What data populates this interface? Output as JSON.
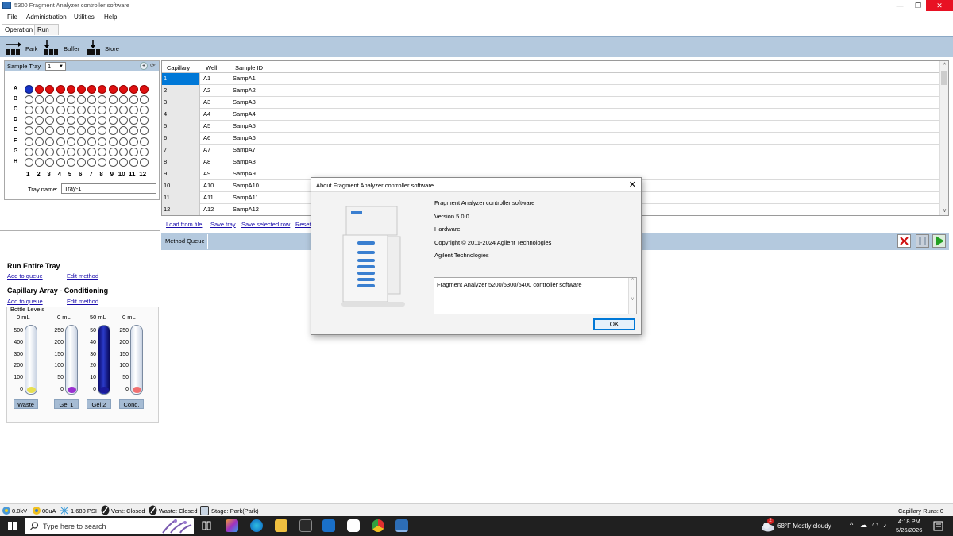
{
  "window": {
    "title": "5300 Fragment Analyzer controller software",
    "minimize": "—",
    "restore": "❐",
    "close": "✕"
  },
  "menu": [
    "File",
    "Administration",
    "Utilities",
    "Help"
  ],
  "tabs": [
    "Operation",
    "Run Status"
  ],
  "toolbar": {
    "park": "Park",
    "buffer": "Buffer",
    "store": "Store"
  },
  "tray": {
    "header_label": "Sample Tray",
    "selected": "1",
    "rows": [
      "A",
      "B",
      "C",
      "D",
      "E",
      "F",
      "G",
      "H"
    ],
    "cols": [
      "1",
      "2",
      "3",
      "4",
      "5",
      "6",
      "7",
      "8",
      "9",
      "10",
      "11",
      "12"
    ],
    "row_a_states": [
      "selected",
      "filled",
      "filled",
      "filled",
      "filled",
      "filled",
      "filled",
      "filled",
      "filled",
      "filled",
      "filled",
      "filled"
    ],
    "name_label": "Tray name:",
    "name_value": "Tray-1"
  },
  "table": {
    "headers": [
      "Capillary",
      "Well",
      "Sample ID"
    ],
    "rows": [
      [
        "1",
        "A1",
        "SampA1"
      ],
      [
        "2",
        "A2",
        "SampA2"
      ],
      [
        "3",
        "A3",
        "SampA3"
      ],
      [
        "4",
        "A4",
        "SampA4"
      ],
      [
        "5",
        "A5",
        "SampA5"
      ],
      [
        "6",
        "A6",
        "SampA6"
      ],
      [
        "7",
        "A7",
        "SampA7"
      ],
      [
        "8",
        "A8",
        "SampA8"
      ],
      [
        "9",
        "A9",
        "SampA9"
      ],
      [
        "10",
        "A10",
        "SampA10"
      ],
      [
        "11",
        "A11",
        "SampA11"
      ],
      [
        "12",
        "A12",
        "SampA12"
      ]
    ]
  },
  "table_links": {
    "load": "Load from file",
    "save_tray": "Save tray",
    "save_row": "Save selected row",
    "reset": "Reset"
  },
  "run_tray": {
    "title": "Run Entire Tray",
    "add": "Add to queue",
    "edit": "Edit method"
  },
  "conditioning": {
    "title": "Capillary Array - Conditioning",
    "add": "Add to queue",
    "edit": "Edit method"
  },
  "bottles": {
    "title": "Bottle Levels",
    "items": [
      {
        "name": "Waste",
        "value": "0 mL",
        "scale": [
          "500",
          "400",
          "300",
          "200",
          "100",
          "0"
        ],
        "bulb": "#e8e050",
        "level": 0
      },
      {
        "name": "Gel 1",
        "value": "0 mL",
        "scale": [
          "250",
          "200",
          "150",
          "100",
          "50",
          "0"
        ],
        "bulb": "#9a30d0",
        "level": 0
      },
      {
        "name": "Gel 2",
        "value": "50 mL",
        "scale": [
          "50",
          "40",
          "30",
          "20",
          "10",
          "0"
        ],
        "bulb": "#1a1a9a",
        "level": 1
      },
      {
        "name": "Cond.",
        "value": "0 mL",
        "scale": [
          "250",
          "200",
          "150",
          "100",
          "50",
          "0"
        ],
        "bulb": "#f07070",
        "level": 0
      }
    ]
  },
  "method_queue": {
    "tab": "Method Queue"
  },
  "dialog": {
    "title": "About Fragment Analyzer controller software",
    "close": "✕",
    "product": "Fragment Analyzer controller software",
    "version": "Version 5.0.0",
    "hardware": "Hardware",
    "copyright": "Copyright © 2011-2024 Agilent Technologies",
    "company": "Agilent Technologies",
    "description": "Fragment Analyzer 5200/5300/5400 controller software",
    "ok": "OK"
  },
  "status": {
    "voltage": "0.0kV",
    "current": "00uA",
    "pressure": "1.680 PSI",
    "vent": "Vent: Closed",
    "waste": "Waste: Closed",
    "stage": "Stage: Park(Park)",
    "runs": "Capillary Runs: 0"
  },
  "taskbar": {
    "search_placeholder": "Type here to search",
    "weather": "68°F  Mostly cloudy",
    "weather_badge": "2",
    "time": "4:18 PM",
    "date": "5/26/2026"
  },
  "colors": {
    "accent_blue": "#b4c9de",
    "well_red": "#e01010",
    "well_blue": "#1632c4",
    "close_red": "#e81123",
    "selection": "#0078d7"
  }
}
